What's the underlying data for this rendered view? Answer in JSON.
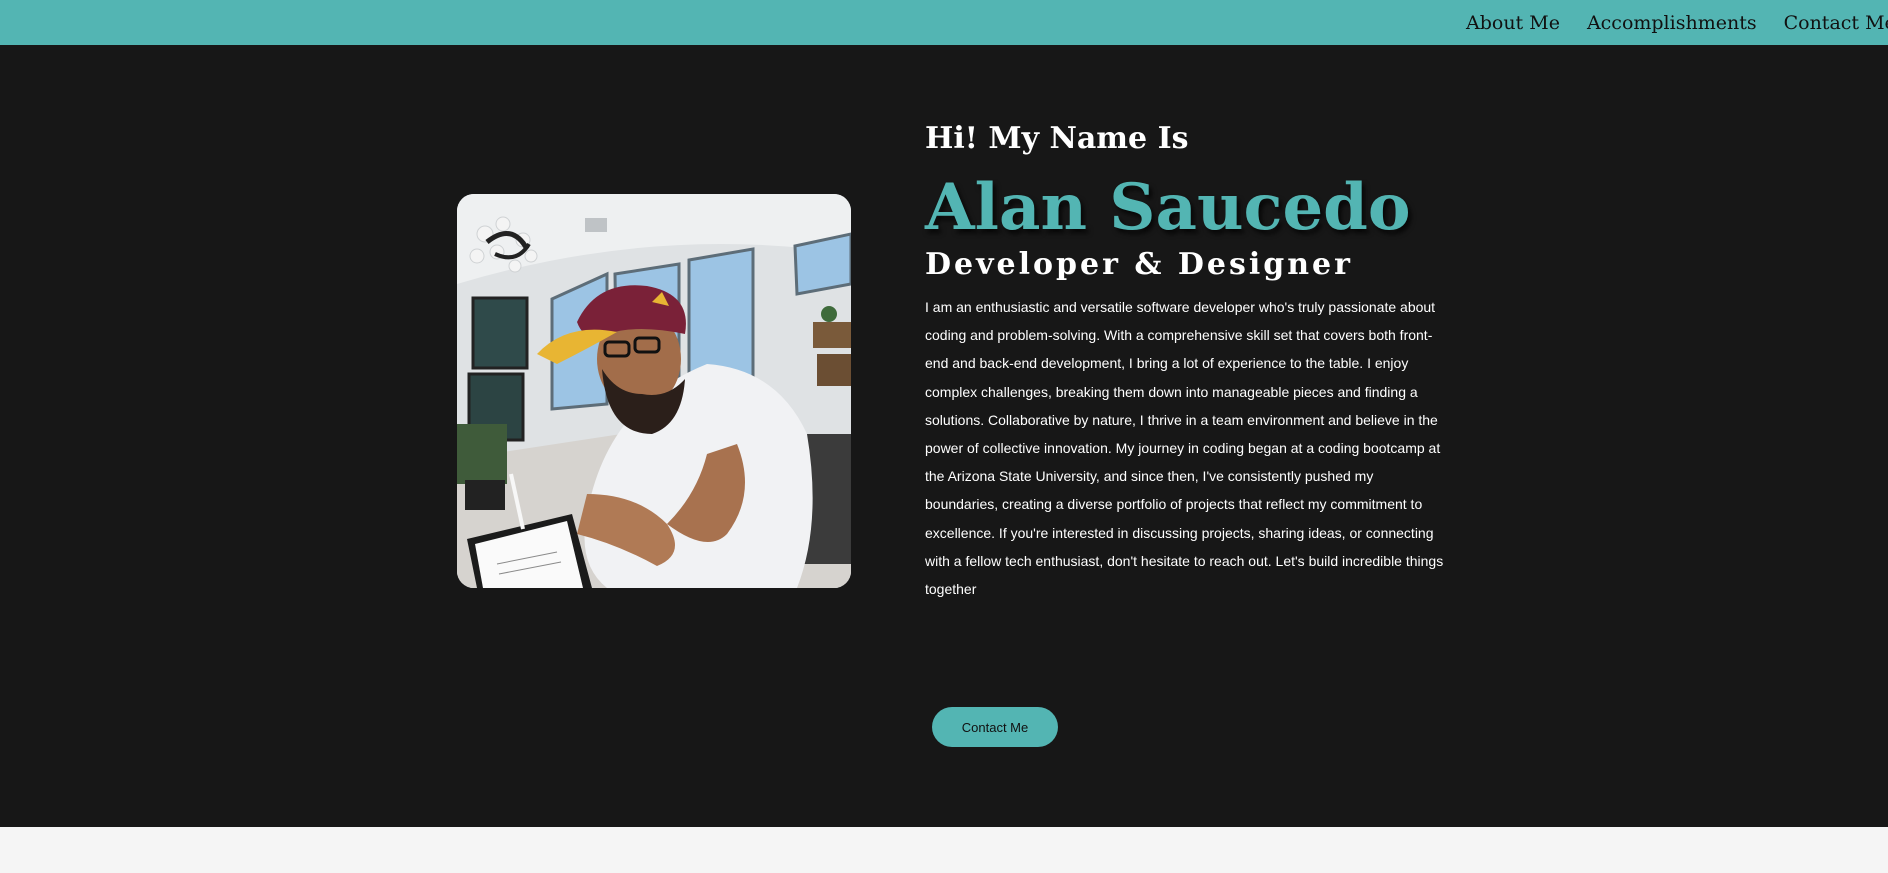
{
  "nav": {
    "links": [
      "About Me",
      "Accomplishments",
      "Contact Me"
    ]
  },
  "hero": {
    "greeting": "Hi! My Name Is",
    "name": "Alan Saucedo",
    "role": "Developer & Designer",
    "bio": "I am an enthusiastic and versatile software developer who's truly passionate about coding and problem-solving. With a comprehensive skill set that covers both front-end and back-end development, I bring a lot of experience to the table. I enjoy complex challenges, breaking them down into manageable pieces and finding a solutions. Collaborative by nature, I thrive in a team environment and believe in the power of collective innovation. My journey in coding began at a coding bootcamp at the Arizona State University, and since then, I've consistently pushed my boundaries, creating a diverse portfolio of projects that reflect my commitment to excellence. If you're interested in discussing projects, sharing ideas, or connecting with a fellow tech enthusiast, don't hesitate to reach out. Let's build incredible things together",
    "contact_button": "Contact Me"
  },
  "colors": {
    "accent": "#53b5b3",
    "hero_background": "#171717",
    "page_background": "#f5f5f5"
  }
}
